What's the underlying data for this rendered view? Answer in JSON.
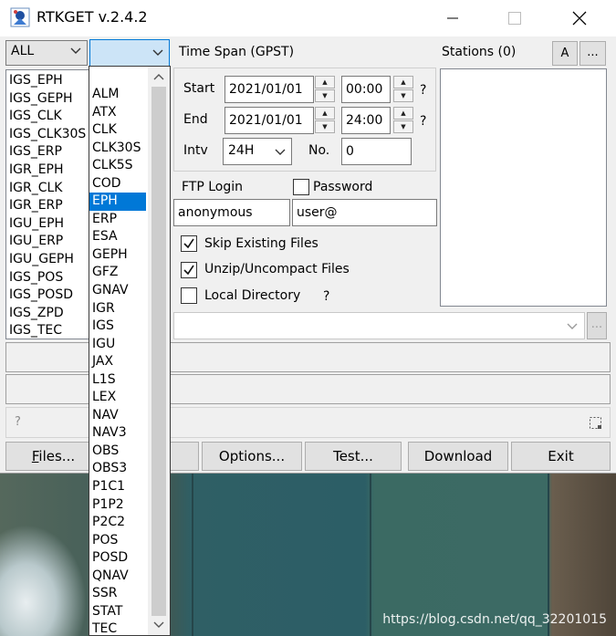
{
  "window": {
    "title": "RTKGET v.2.4.2",
    "minimize": "—",
    "maximize": "☐",
    "close": "✕"
  },
  "type_combo": {
    "value": "ALL"
  },
  "product_combo": {
    "value": ""
  },
  "left_list": {
    "items": [
      "IGS_EPH",
      "IGS_GEPH",
      "IGS_CLK",
      "IGS_CLK30S",
      "IGS_ERP",
      "IGR_EPH",
      "IGR_CLK",
      "IGR_ERP",
      "IGU_EPH",
      "IGU_ERP",
      "IGU_GEPH",
      "IGS_POS",
      "IGS_POSD",
      "IGS_ZPD",
      "IGS_TEC"
    ]
  },
  "dropdown": {
    "items": [
      "ALM",
      "ATX",
      "CLK",
      "CLK30S",
      "CLK5S",
      "COD",
      "EPH",
      "ERP",
      "ESA",
      "GEPH",
      "GFZ",
      "GNAV",
      "IGR",
      "IGS",
      "IGU",
      "JAX",
      "L1S",
      "LEX",
      "NAV",
      "NAV3",
      "OBS",
      "OBS3",
      "P1C1",
      "P1P2",
      "P2C2",
      "POS",
      "POSD",
      "QNAV",
      "SSR",
      "STAT",
      "TEC"
    ],
    "selected": "EPH"
  },
  "time_span": {
    "label": "Time Span (GPST)",
    "start_label": "Start",
    "start_date": "2021/01/01",
    "start_time": "00:00",
    "end_label": "End",
    "end_date": "2021/01/01",
    "end_time": "24:00",
    "intv_label": "Intv",
    "intv_value": "24H",
    "no_label": "No.",
    "no_value": "0",
    "help": "?"
  },
  "ftp": {
    "login_label": "FTP Login",
    "password_label": "Password",
    "login_value": "anonymous",
    "password_value": "user@"
  },
  "options": {
    "skip_existing": {
      "label": "Skip Existing Files",
      "checked": true
    },
    "unzip": {
      "label": "Unzip/Uncompact Files",
      "checked": true
    },
    "local_dir": {
      "label": "Local Directory",
      "checked": false
    },
    "help": "?"
  },
  "stations": {
    "label": "Stations (0)",
    "a_button": "A",
    "more_button": "..."
  },
  "dir_combo": {
    "value": "",
    "more_button": "..."
  },
  "status": {
    "help": "?"
  },
  "buttons": {
    "files": "Files...",
    "options": "Options...",
    "test": "Test...",
    "download": "Download",
    "exit": "Exit"
  },
  "watermark": "https://blog.csdn.net/qq_32201015"
}
